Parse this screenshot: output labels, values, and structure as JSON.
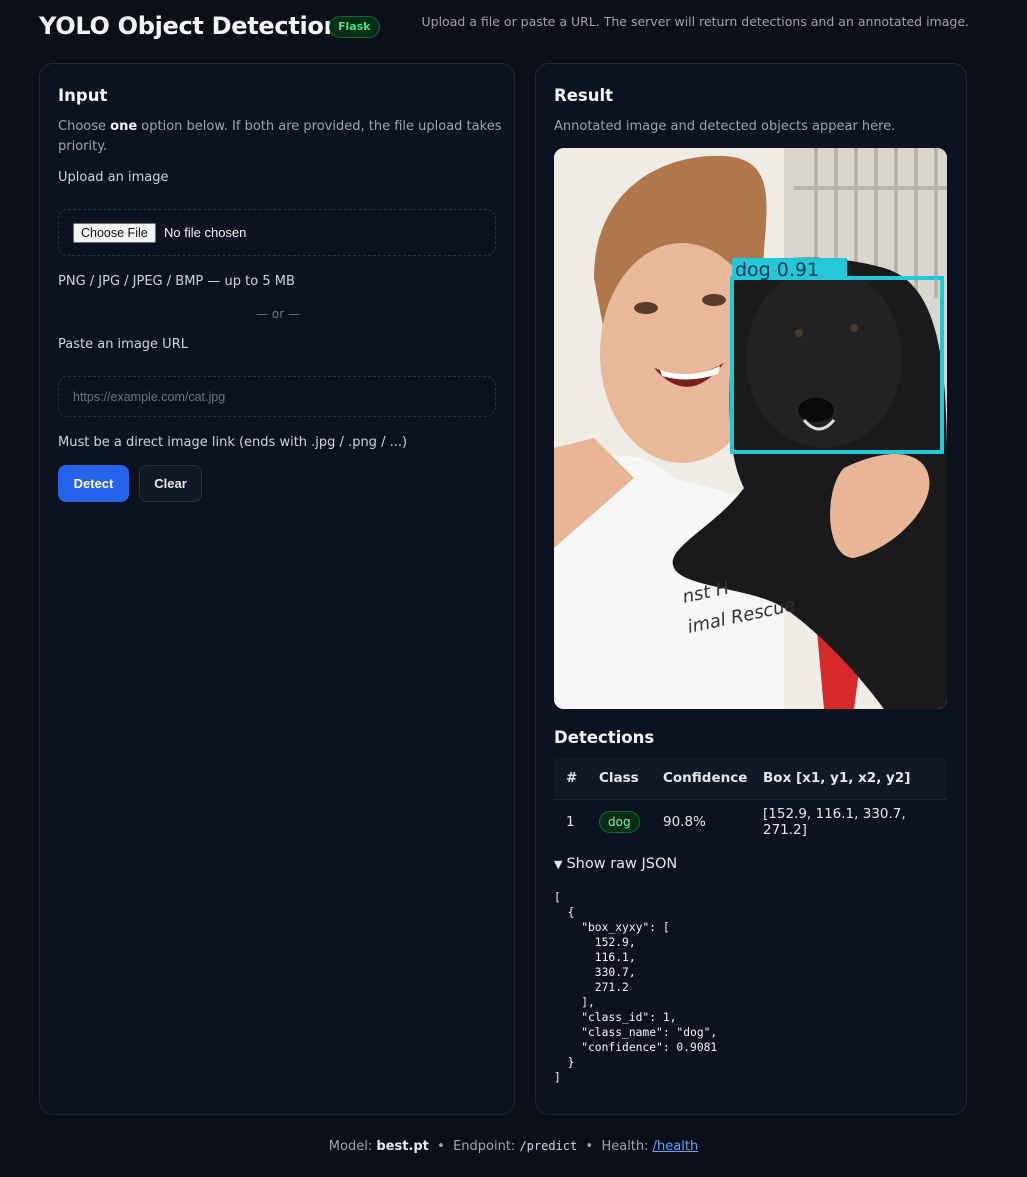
{
  "header": {
    "title": "YOLO Object Detection",
    "badge": "Flask",
    "subtitle": "Upload a file or paste a URL. The server will return detections and an annotated image."
  },
  "input_panel": {
    "title": "Input",
    "intro_prefix": "Choose ",
    "intro_bold": "one",
    "intro_suffix": " option below. If both are provided, the file upload takes priority.",
    "upload_label": "Upload an image",
    "file_button": "Choose File",
    "file_status": "No file chosen",
    "file_hint": "PNG / JPG / JPEG / BMP — up to 5 MB",
    "or_divider": "— or —",
    "url_label": "Paste an image URL",
    "url_placeholder": "https://example.com/cat.jpg",
    "url_value": "",
    "url_hint": "Must be a direct image link (ends with .jpg / .png / ...)",
    "detect_button": "Detect",
    "clear_button": "Clear"
  },
  "result_panel": {
    "title": "Result",
    "subtitle": "Annotated image and detected objects appear here.",
    "image_overlay_label": "dog 0.91",
    "detections_title": "Detections",
    "table_headers": [
      "#",
      "Class",
      "Confidence",
      "Box [x1, y1, x2, y2]"
    ],
    "rows": [
      {
        "num": "1",
        "class": "dog",
        "confidence": "90.8%",
        "box": "[152.9, 116.1, 330.7, 271.2]"
      }
    ],
    "raw_toggle": "Show raw JSON",
    "raw_json": "[\n  {\n    \"box_xyxy\": [\n      152.9,\n      116.1,\n      330.7,\n      271.2\n    ],\n    \"class_id\": 1,\n    \"class_name\": \"dog\",\n    \"confidence\": 0.9081\n  }\n]"
  },
  "footer": {
    "model_label": "Model: ",
    "model_value": "best.pt",
    "sep": "•",
    "endpoint_label": "Endpoint: ",
    "endpoint_value": "/predict",
    "health_label": "Health: ",
    "health_link": "/health"
  },
  "colors": {
    "background": "#0b0f19",
    "accent": "#2563eb",
    "badge_green": "#4ade80",
    "bbox": "#22c7d8"
  }
}
